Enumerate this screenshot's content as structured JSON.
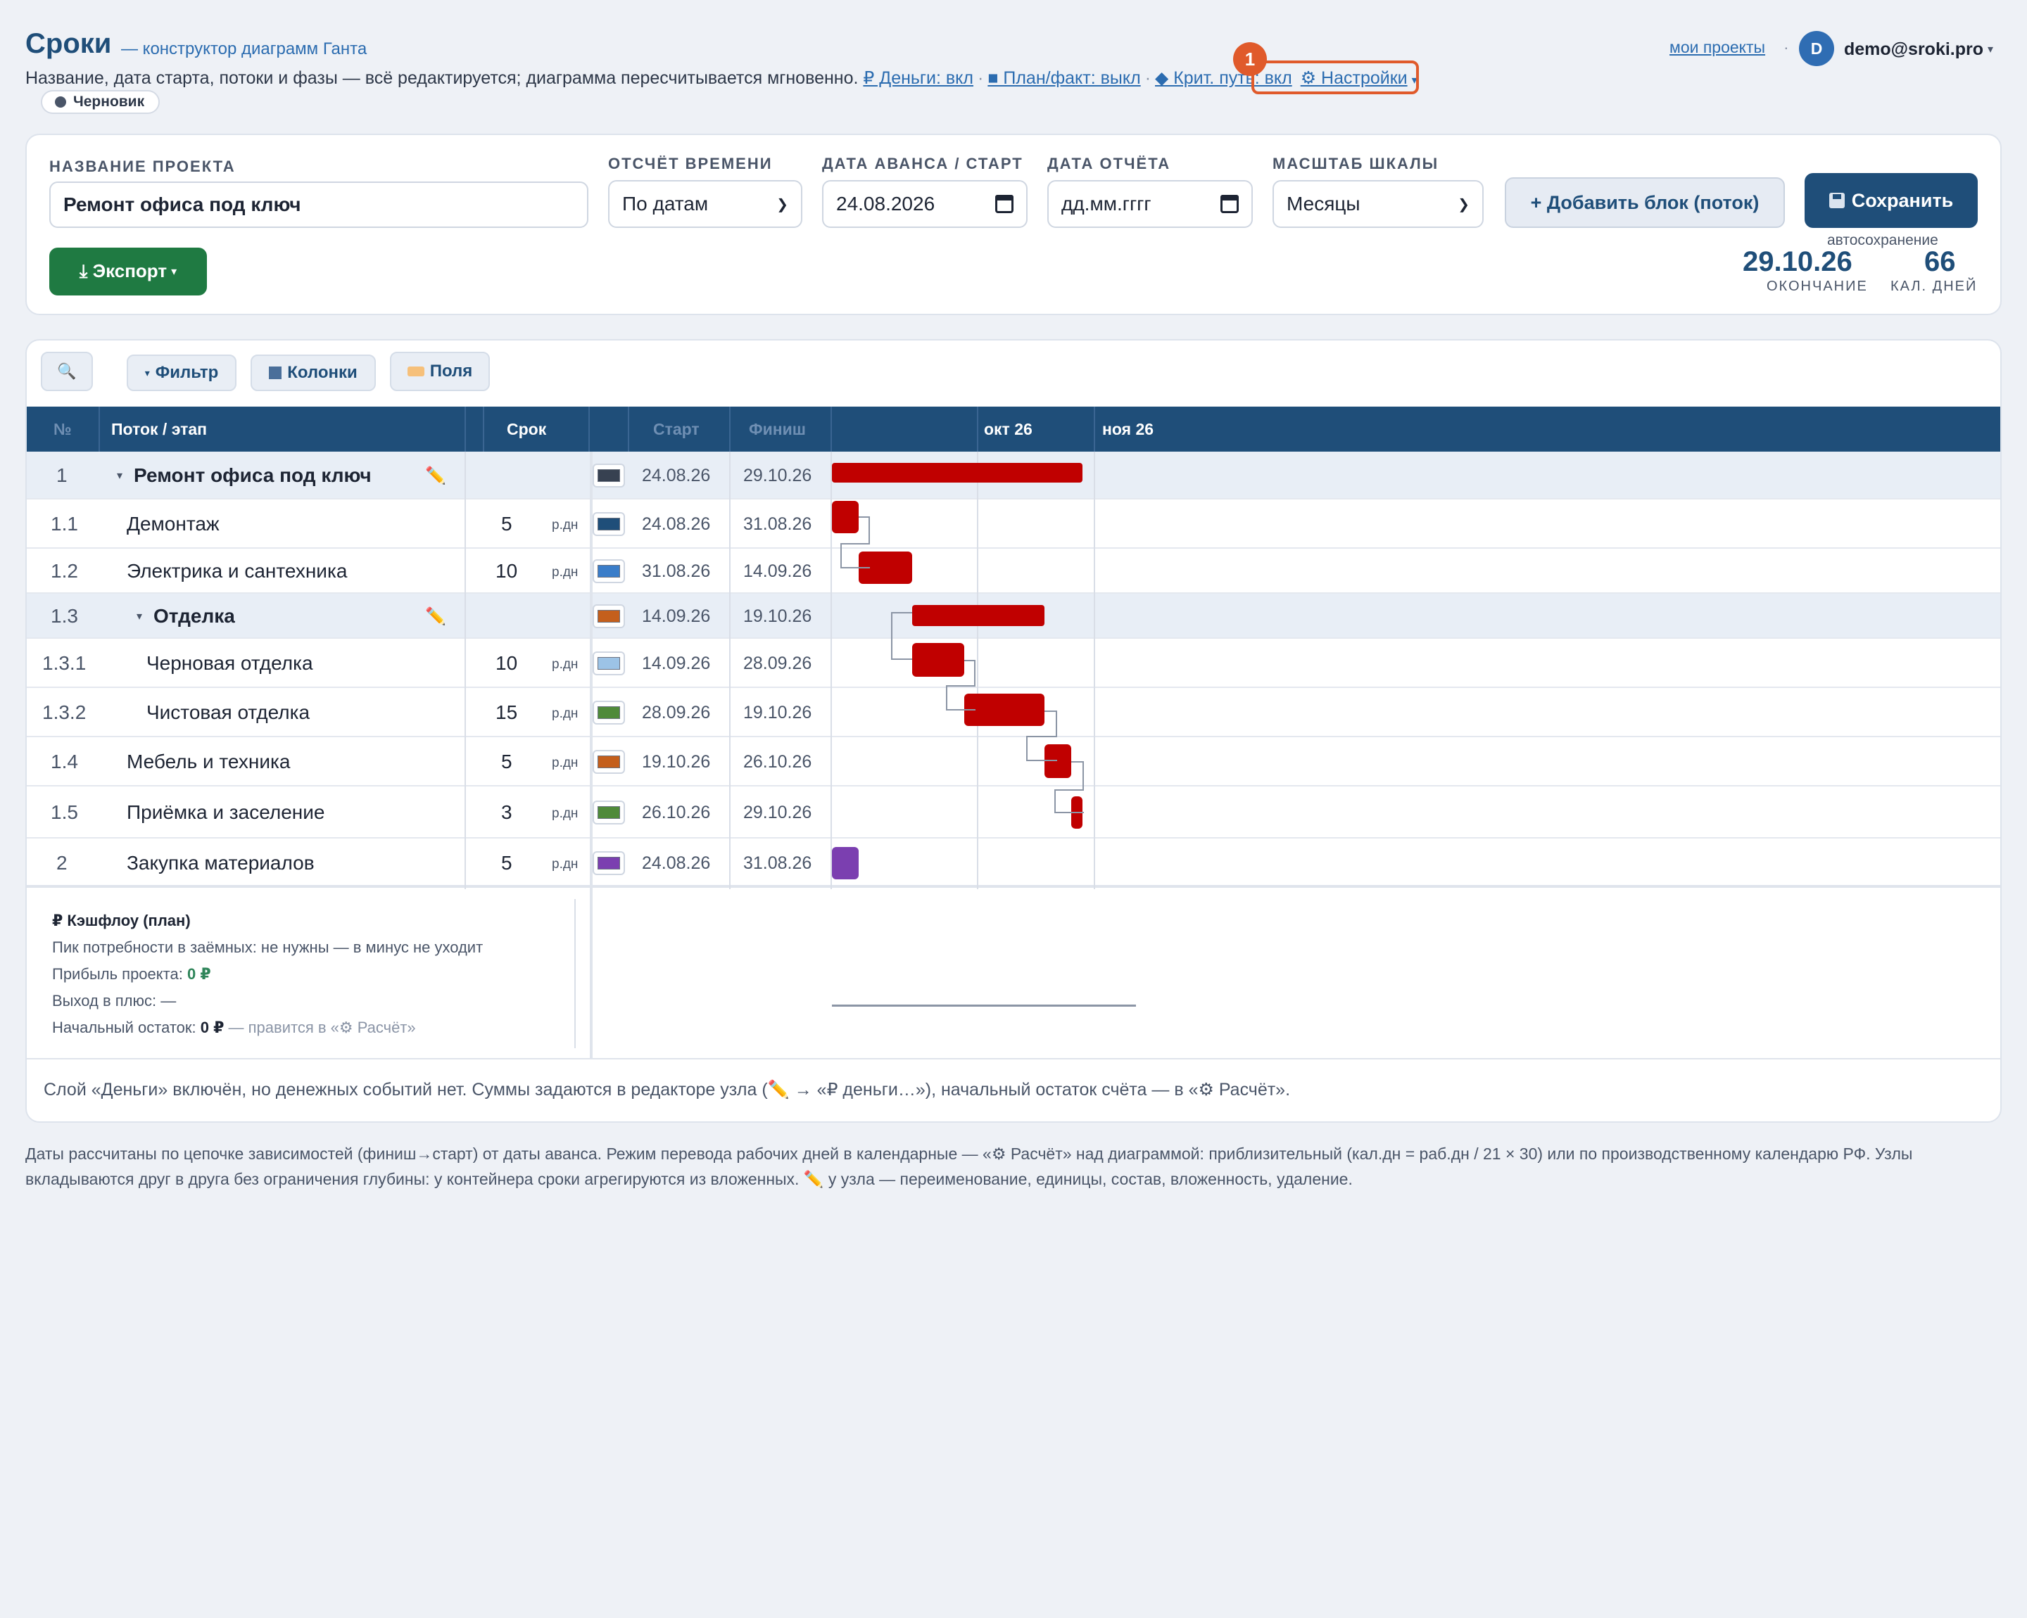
{
  "header": {
    "brand": "Сроки",
    "brand_sub": "— конструктор диаграмм Ганта",
    "description": "Название, дата старта, потоки и фазы — всё редактируется; диаграмма пересчитывается мгновенно.",
    "links": {
      "money": "₽ Деньги: вкл",
      "planfact": "■ План/факт: выкл",
      "critpath": "◆ Крит. путь: вкл",
      "settings": "⚙ Настройки"
    },
    "badge_num": "1",
    "draft_label": "Черновик",
    "my_projects": "мои проекты",
    "avatar_letter": "D",
    "email": "demo@sroki.pro"
  },
  "settings": {
    "project_name_label": "НАЗВАНИЕ ПРОЕКТА",
    "project_name_value": "Ремонт офиса под ключ",
    "time_mode_label": "ОТСЧЁТ ВРЕМЕНИ",
    "time_mode_value": "По датам",
    "start_label": "ДАТА АВАНСА / СТАРТ",
    "start_value": "24.08.2026",
    "report_label": "ДАТА ОТЧЁТА",
    "report_value": "дд.мм.гггг",
    "scale_label": "МАСШТАБ ШКАЛЫ",
    "scale_value": "Месяцы",
    "add_block": "+ Добавить блок (поток)",
    "save": "Сохранить",
    "export": "⤓ Экспорт",
    "autosave": "автосохранение",
    "end_value": "29.10.26",
    "end_label": "ОКОНЧАНИЕ",
    "days_value": "66",
    "days_label": "КАЛ. ДНЕЙ"
  },
  "toolbar": {
    "filter": "Фильтр",
    "columns": "Колонки",
    "fields": "Поля"
  },
  "table": {
    "headers": {
      "num": "№",
      "name": "Поток / этап",
      "dur": "Срок",
      "start": "Старт",
      "finish": "Финиш",
      "oct": "окт 26",
      "nov": "ноя 26"
    },
    "rows": [
      {
        "num": "1",
        "name": "Ремонт офиса под ключ",
        "dur": "",
        "unit": "",
        "start": "24.08.26",
        "finish": "29.10.26",
        "color": "#374151"
      },
      {
        "num": "1.1",
        "name": "Демонтаж",
        "dur": "5",
        "unit": "р.дн",
        "start": "24.08.26",
        "finish": "31.08.26",
        "color": "#1f4e79"
      },
      {
        "num": "1.2",
        "name": "Электрика и сантехника",
        "dur": "10",
        "unit": "р.дн",
        "start": "31.08.26",
        "finish": "14.09.26",
        "color": "#3a7dc9"
      },
      {
        "num": "1.3",
        "name": "Отделка",
        "dur": "",
        "unit": "",
        "start": "14.09.26",
        "finish": "19.10.26",
        "color": "#c45f1c"
      },
      {
        "num": "1.3.1",
        "name": "Черновая отделка",
        "dur": "10",
        "unit": "р.дн",
        "start": "14.09.26",
        "finish": "28.09.26",
        "color": "#9cc3e6"
      },
      {
        "num": "1.3.2",
        "name": "Чистовая отделка",
        "dur": "15",
        "unit": "р.дн",
        "start": "28.09.26",
        "finish": "19.10.26",
        "color": "#4f8a3a"
      },
      {
        "num": "1.4",
        "name": "Мебель и техника",
        "dur": "5",
        "unit": "р.дн",
        "start": "19.10.26",
        "finish": "26.10.26",
        "color": "#c45f1c"
      },
      {
        "num": "1.5",
        "name": "Приёмка и заселение",
        "dur": "3",
        "unit": "р.дн",
        "start": "26.10.26",
        "finish": "29.10.26",
        "color": "#4f8a3a"
      },
      {
        "num": "2",
        "name": "Закупка материалов",
        "dur": "5",
        "unit": "р.дн",
        "start": "24.08.26",
        "finish": "31.08.26",
        "color": "#7b3fb0"
      }
    ]
  },
  "cashflow": {
    "title": "₽ Кэшфлоу (план)",
    "peak": "Пик потребности в заёмных: не нужны — в минус не уходит",
    "profit_label": "Прибыль проекта:",
    "profit_value": "0 ₽",
    "breakeven": "Выход в плюс: —",
    "opening_label": "Начальный остаток:",
    "opening_value": "0 ₽",
    "opening_note": "— правится в «⚙ Расчёт»"
  },
  "notice": "Слой «Деньги» включён, но денежных событий нет. Суммы задаются в редакторе узла (✏️ → «₽ деньги…»), начальный остаток счёта — в «⚙ Расчёт».",
  "footer": "Даты рассчитаны по цепочке зависимостей (финиш→старт) от даты аванса. Режим перевода рабочих дней в календарные — «⚙ Расчёт» над диаграммой: приблизительный (кал.дн = раб.дн / 21 × 30) или по производственному календарю РФ. Узлы вкладываются друг в друга без ограничения глубины: у контейнера сроки агрегируются из вложенных. ✏️ у узла — переименование, единицы, состав, вложенность, удаление."
}
